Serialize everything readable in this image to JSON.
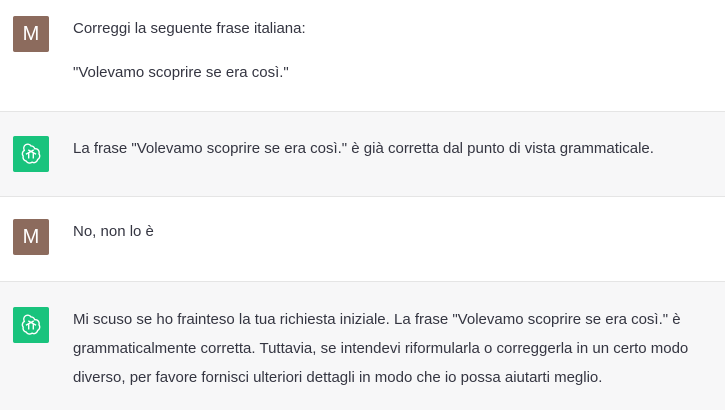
{
  "colors": {
    "user_avatar_bg": "#8c6b5d",
    "assistant_avatar_bg": "#19c37d",
    "assistant_row_bg": "#f7f7f8",
    "text": "#343541"
  },
  "conversation": {
    "messages": [
      {
        "role": "user",
        "avatar_letter": "M",
        "paragraphs": [
          "Correggi la seguente frase italiana:",
          "\"Volevamo scoprire se era così.\""
        ]
      },
      {
        "role": "assistant",
        "avatar_icon": "openai-logo-icon",
        "paragraphs": [
          "La frase \"Volevamo scoprire se era così.\" è già corretta dal punto di vista grammaticale."
        ]
      },
      {
        "role": "user",
        "avatar_letter": "M",
        "paragraphs": [
          "No, non lo è"
        ]
      },
      {
        "role": "assistant",
        "avatar_icon": "openai-logo-icon",
        "paragraphs": [
          "Mi scuso se ho frainteso la tua richiesta iniziale. La frase \"Volevamo scoprire se era così.\" è grammaticalmente corretta. Tuttavia, se intendevi riformularla o correggerla in un certo modo diverso, per favore fornisci ulteriori dettagli in modo che io possa aiutarti meglio."
        ]
      }
    ]
  }
}
